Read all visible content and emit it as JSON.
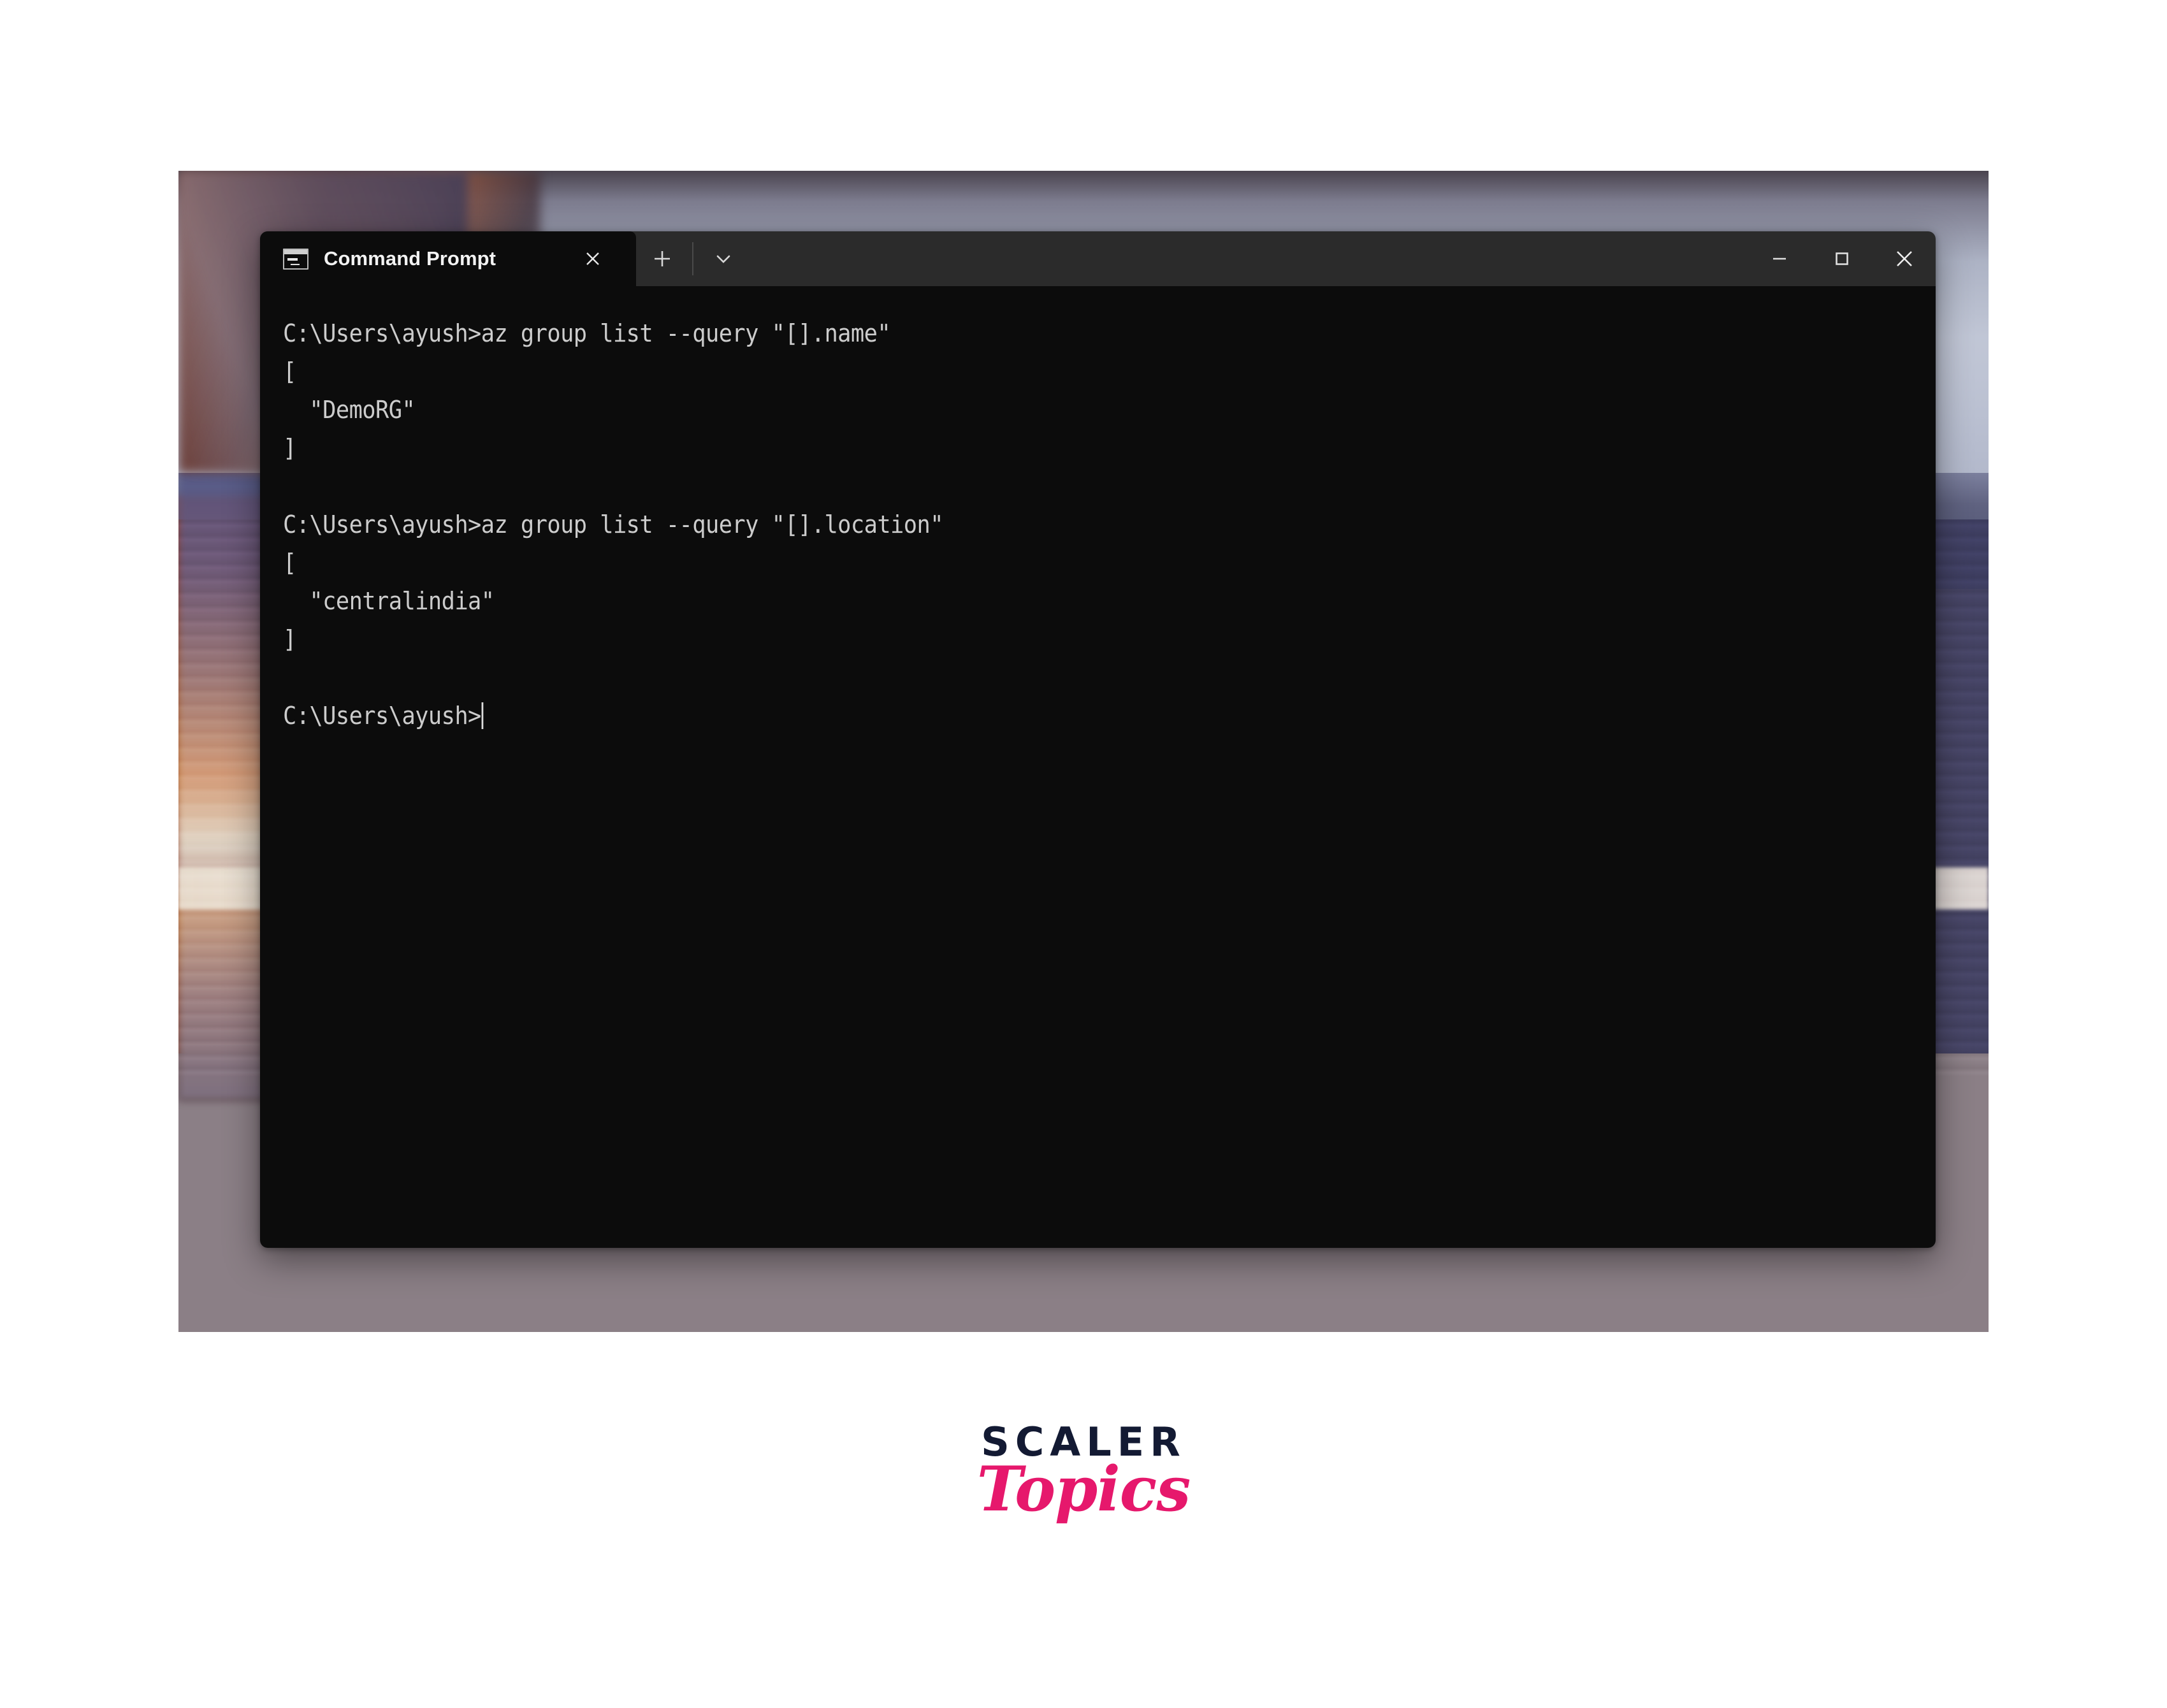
{
  "window": {
    "app_title": "Command Prompt",
    "tab_label": "Command Prompt",
    "tab_icon": "console-window-icon",
    "close_tab_icon": "close-icon",
    "new_tab_icon": "plus-icon",
    "dropdown_icon": "chevron-down-icon",
    "minimize_icon": "minimize-icon",
    "maximize_icon": "maximize-icon",
    "close_window_icon": "close-icon"
  },
  "terminal": {
    "background": "#0c0c0c",
    "foreground": "#cccccc",
    "prompt": "C:\\Users\\ayush>",
    "lines": [
      "C:\\Users\\ayush>az group list --query \"[].name\"",
      "[",
      "  \"DemoRG\"",
      "]",
      "",
      "C:\\Users\\ayush>az group list --query \"[].location\"",
      "[",
      "  \"centralindia\"",
      "]",
      "",
      "C:\\Users\\ayush>"
    ],
    "commands": [
      {
        "command": "az group list --query \"[].name\"",
        "output": [
          "[",
          "  \"DemoRG\"",
          "]"
        ]
      },
      {
        "command": "az group list --query \"[].location\"",
        "output": [
          "[",
          "  \"centralindia\"",
          "]"
        ]
      }
    ],
    "cursor_visible": true
  },
  "logo": {
    "primary": "SCALER",
    "secondary": "Topics",
    "primary_color": "#131a33",
    "secondary_color": "#e6186c"
  }
}
